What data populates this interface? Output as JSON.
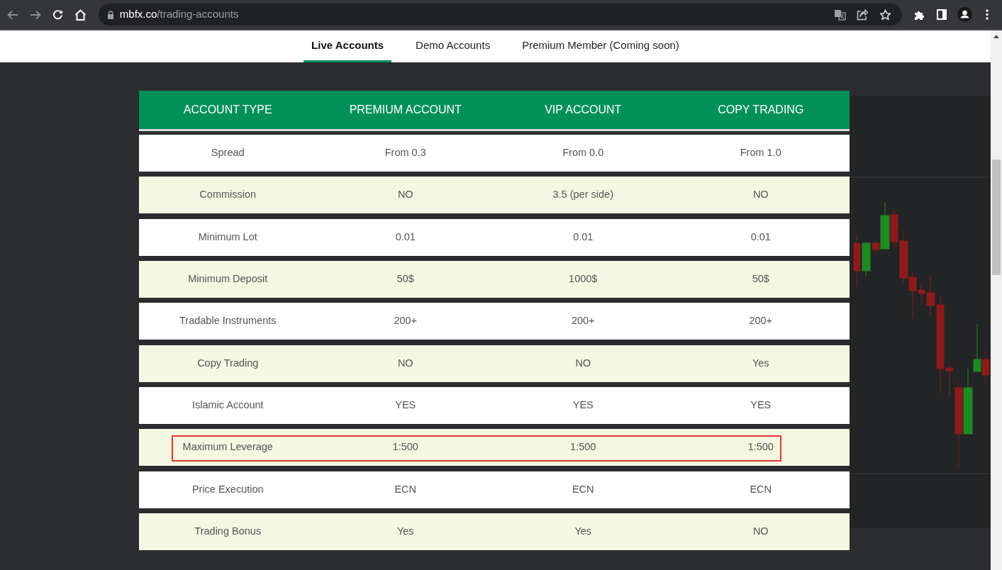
{
  "browser": {
    "url_host": "mbfx.co",
    "url_path": "/trading-accounts"
  },
  "tabs": [
    {
      "label": "Live Accounts",
      "selected": true
    },
    {
      "label": "Demo Accounts",
      "selected": false
    },
    {
      "label": "Premium Member (Coming soon)",
      "selected": false
    }
  ],
  "table": {
    "columns": [
      "ACCOUNT TYPE",
      "PREMIUM ACCOUNT",
      "VIP ACCOUNT",
      "COPY TRADING"
    ],
    "rows": [
      {
        "cells": [
          "Spread",
          "From 0.3",
          "From 0.0",
          "From 1.0"
        ],
        "highlighted": false
      },
      {
        "cells": [
          "Commission",
          "NO",
          "3.5 (per side)",
          "NO"
        ],
        "highlighted": false
      },
      {
        "cells": [
          "Minimum Lot",
          "0.01",
          "0.01",
          "0.01"
        ],
        "highlighted": false
      },
      {
        "cells": [
          "Minimum Deposit",
          "50$",
          "1000$",
          "50$"
        ],
        "highlighted": false
      },
      {
        "cells": [
          "Tradable Instruments",
          "200+",
          "200+",
          "200+"
        ],
        "highlighted": false
      },
      {
        "cells": [
          "Copy Trading",
          "NO",
          "NO",
          "Yes"
        ],
        "highlighted": false
      },
      {
        "cells": [
          "Islamic Account",
          "YES",
          "YES",
          "YES"
        ],
        "highlighted": false
      },
      {
        "cells": [
          "Maximum Leverage",
          "1:500",
          "1:500",
          "1:500"
        ],
        "highlighted": true
      },
      {
        "cells": [
          "Price Execution",
          "ECN",
          "ECN",
          "ECN"
        ],
        "highlighted": false
      },
      {
        "cells": [
          "Trading Bonus",
          "Yes",
          "Yes",
          "NO"
        ],
        "highlighted": false
      }
    ]
  }
}
